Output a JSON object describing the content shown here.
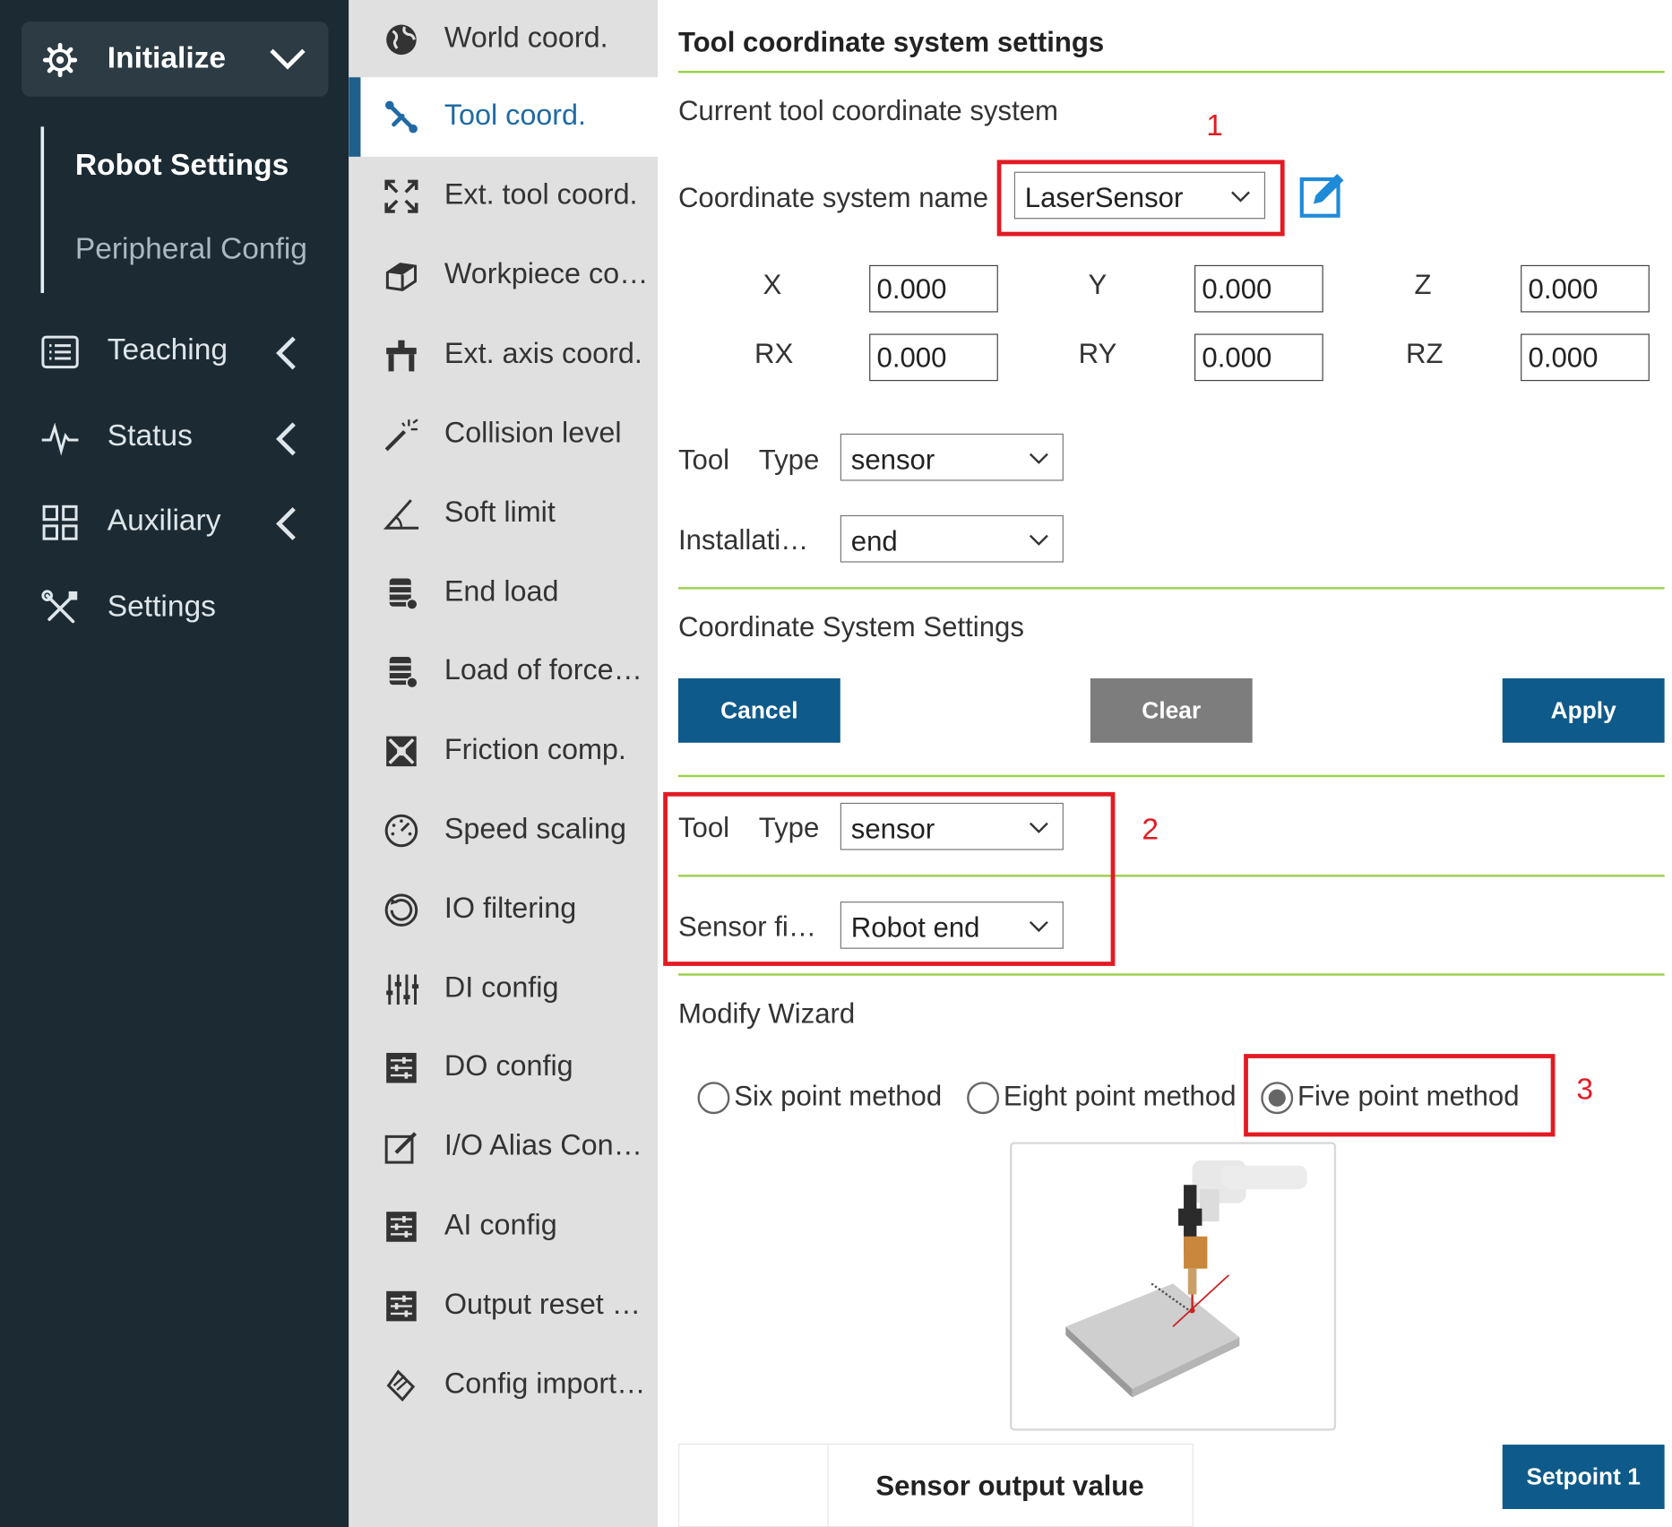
{
  "leftnav": {
    "initialize_label": "Initialize",
    "robot_settings": "Robot Settings",
    "peripheral_config": "Peripheral Config",
    "items": [
      {
        "label": "Teaching",
        "icon": "list-icon"
      },
      {
        "label": "Status",
        "icon": "pulse-icon"
      },
      {
        "label": "Auxiliary",
        "icon": "grid-icon"
      },
      {
        "label": "Settings",
        "icon": "tools-icon"
      }
    ]
  },
  "submenu": {
    "items": [
      {
        "label": "World coord.",
        "icon": "globe-icon"
      },
      {
        "label": "Tool coord.",
        "icon": "wrench-icon",
        "active": true
      },
      {
        "label": "Ext. tool coord.",
        "icon": "expand-icon"
      },
      {
        "label": "Workpiece co…",
        "icon": "cube-icon"
      },
      {
        "label": "Ext. axis coord.",
        "icon": "axis-icon"
      },
      {
        "label": "Collision level",
        "icon": "wand-icon"
      },
      {
        "label": "Soft limit",
        "icon": "angle-icon"
      },
      {
        "label": "End load",
        "icon": "database-icon"
      },
      {
        "label": "Load of force/…",
        "icon": "database-icon"
      },
      {
        "label": "Friction comp.",
        "icon": "friction-icon"
      },
      {
        "label": "Speed scaling",
        "icon": "gauge-icon"
      },
      {
        "label": "IO filtering",
        "icon": "filter-icon"
      },
      {
        "label": "DI config",
        "icon": "sliders-icon"
      },
      {
        "label": "DO config",
        "icon": "sliders-box-icon"
      },
      {
        "label": "I/O Alias Conf…",
        "icon": "edit-icon"
      },
      {
        "label": "AI config",
        "icon": "sliders-box-icon"
      },
      {
        "label": "Output reset …",
        "icon": "sliders-box-icon"
      },
      {
        "label": "Config import…",
        "icon": "import-icon"
      }
    ]
  },
  "main": {
    "title": "Tool coordinate system settings",
    "current_section": "Current tool coordinate system",
    "coord_name_label": "Coordinate system name",
    "coord_name_value": "LaserSensor",
    "axes": [
      {
        "label": "X",
        "value": "0.000"
      },
      {
        "label": "Y",
        "value": "0.000"
      },
      {
        "label": "Z",
        "value": "0.000"
      },
      {
        "label": "RX",
        "value": "0.000"
      },
      {
        "label": "RY",
        "value": "0.000"
      },
      {
        "label": "RZ",
        "value": "0.000"
      }
    ],
    "tool_label": "Tool",
    "type_label": "Type",
    "tool_type_value": "sensor",
    "installation_label": "Installati…",
    "installation_value": "end",
    "settings_section": "Coordinate System Settings",
    "cancel": "Cancel",
    "clear": "Clear",
    "apply": "Apply",
    "tool_type2_value": "sensor",
    "sensor_fix_label": "Sensor fi…",
    "sensor_fix_value": "Robot end",
    "wizard_title": "Modify Wizard",
    "methods": [
      {
        "label": "Six point method",
        "selected": false
      },
      {
        "label": "Eight point method",
        "selected": false
      },
      {
        "label": "Five point method",
        "selected": true
      }
    ],
    "sensor_output": "Sensor output value",
    "setpoint": "Setpoint 1",
    "annotations": [
      "1",
      "2",
      "3"
    ]
  },
  "colors": {
    "nav_bg": "#1b2a33",
    "accent": "#0e5a8a",
    "green_line": "#9ccf4a",
    "annotation_red": "#e21b23"
  }
}
